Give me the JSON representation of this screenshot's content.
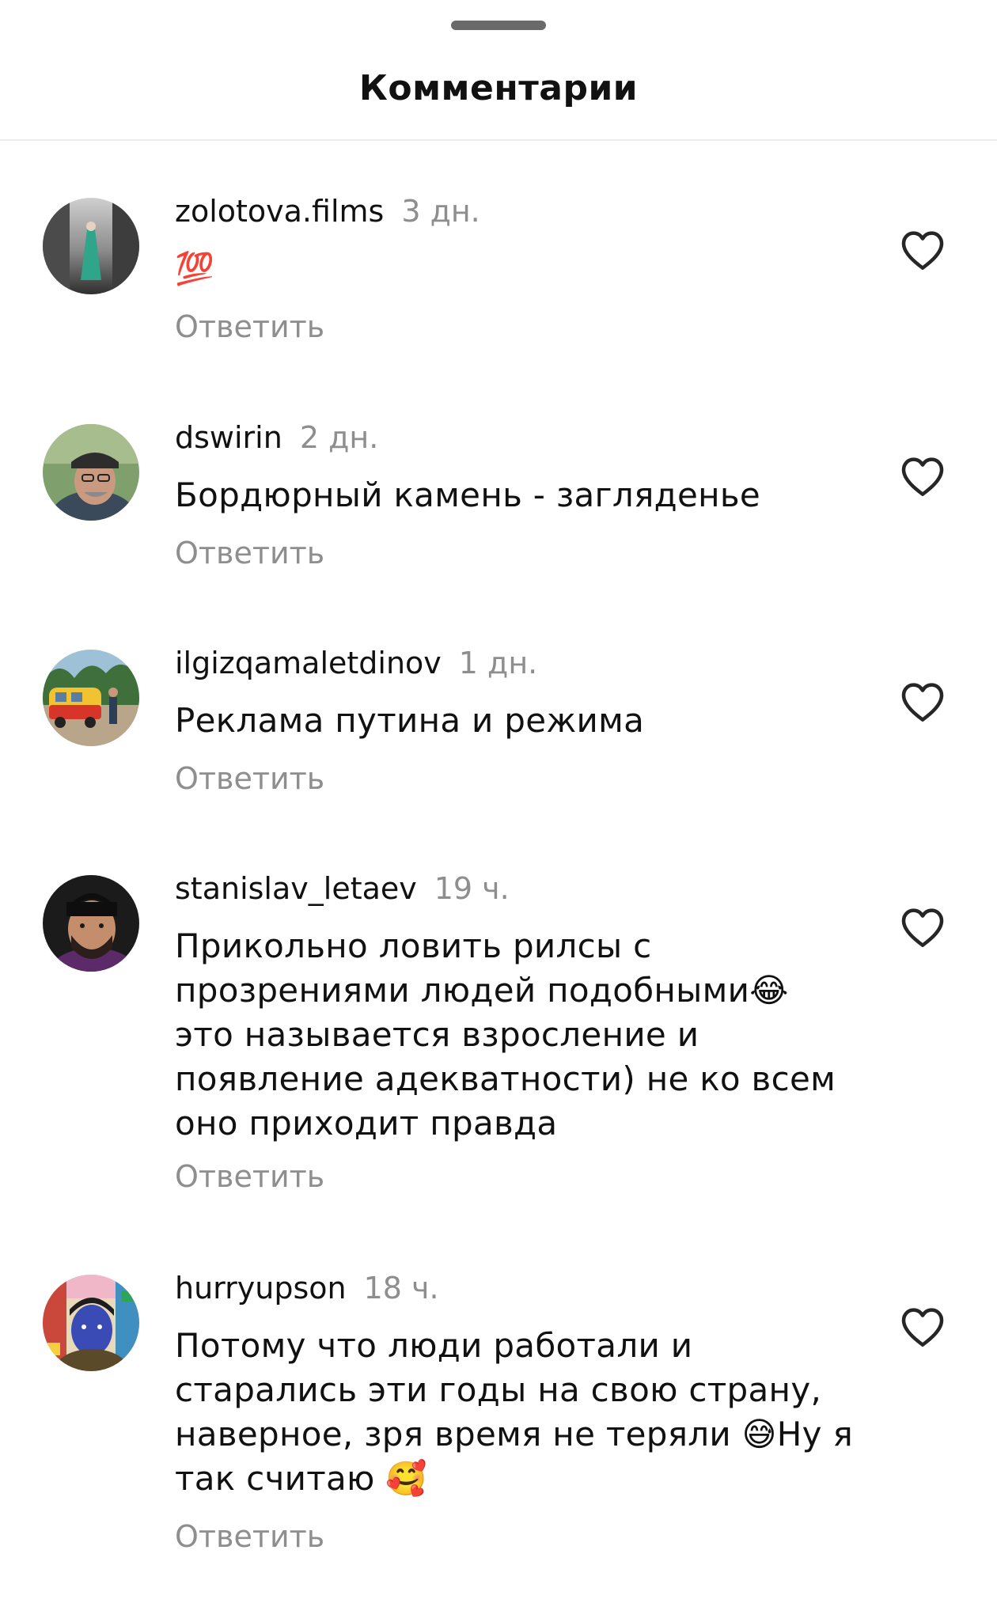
{
  "sheet": {
    "title": "Комментарии"
  },
  "comments": [
    {
      "username": "zolotova.films",
      "time": "3 дн.",
      "text": "💯",
      "reply": "Ответить"
    },
    {
      "username": "dswirin",
      "time": "2 дн.",
      "text": "Бордюрный камень - загляденье",
      "reply": "Ответить"
    },
    {
      "username": "ilgizqamaletdinov",
      "time": "1 дн.",
      "text": "Реклама путина и режима",
      "reply": "Ответить"
    },
    {
      "username": "stanislav_letaev",
      "time": "19 ч.",
      "text": "Прикольно ловить рилсы с прозрениями людей подобными😂 это называется взросление и появление адекватности) не ко всем оно приходит правда",
      "reply": "Ответить"
    },
    {
      "username": "hurryupson",
      "time": "18 ч.",
      "text": "Потому что люди работали и старались эти годы на свою страну, наверное, зря время не теряли 😅Ну я так считаю 🥰",
      "reply": "Ответить"
    }
  ],
  "icons": {
    "like": "heart-outline-icon",
    "handle": "drag-handle"
  },
  "colors": {
    "text": "#111111",
    "secondary": "#8e8e8e",
    "handle": "#6a6a6a",
    "divider": "#ececec"
  }
}
